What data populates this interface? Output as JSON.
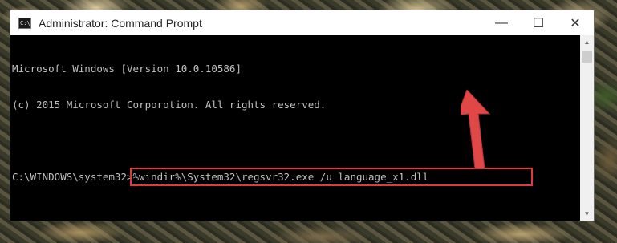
{
  "window": {
    "title": "Administrator: Command Prompt",
    "controls": {
      "minimize": "—",
      "maximize": "☐",
      "close": "✕"
    }
  },
  "icons": {
    "app": "cmd-icon",
    "arrow": "red-arrow-annotation"
  },
  "console": {
    "lines": [
      "Microsoft Windows [Version 10.0.10586]",
      "(c) 2015 Microsoft Corporotion. All rights reserved.",
      ""
    ],
    "prompt": "C:\\WINDOWS\\system32>",
    "command": "%windir%\\System32\\regsvr32.exe /u language_x1.dll"
  },
  "colors": {
    "highlight": "#e03a3a",
    "arrow": "#e04848",
    "console_text": "#c0c0c0",
    "console_bg": "#000000"
  }
}
